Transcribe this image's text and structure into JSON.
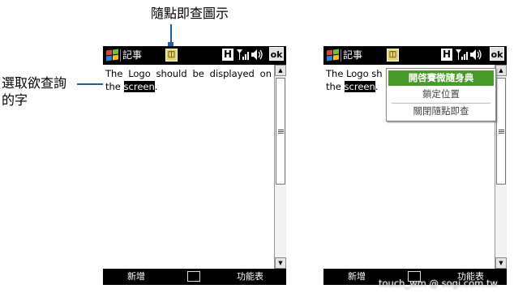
{
  "callouts": {
    "top": "隨點即查圖示",
    "left_line1": "選取欲查詢",
    "left_line2": "的字"
  },
  "screens": [
    {
      "title": "記事",
      "text_before": "The Logo should be displayed on the ",
      "selected_word": "screen",
      "text_after": ".",
      "softkey_left": "新增",
      "softkey_right": "功能表",
      "ok": "ok",
      "icons": [
        "windows-start-icon",
        "lookup-icon",
        "h-icon",
        "signal-icon",
        "speaker-icon",
        "keyboard-icon"
      ]
    },
    {
      "title": "記事",
      "text_before": "The Logo sh",
      "text_line2": "the ",
      "selected_word": "screen",
      "text_after": ".",
      "softkey_left": "新增",
      "softkey_right": "功能表",
      "ok": "ok",
      "popup": {
        "items": [
          "開啓賽微隨身典",
          "鎖定位置",
          "關閉隨點即查"
        ],
        "active_index": 0
      }
    }
  ],
  "watermark": "touch_wm   @ sogi.com.tw",
  "colors": {
    "accent_line": "#1f5f9a",
    "popup_active": "#4a9a2a",
    "lookup_icon": "#e8d46a"
  }
}
